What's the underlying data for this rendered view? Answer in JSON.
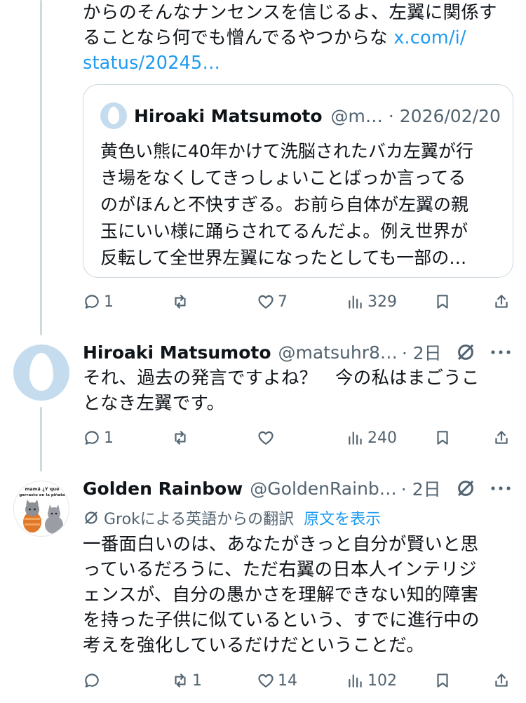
{
  "tweet1": {
    "text_line1": "からのそんなナンセンスを信じるよ、左翼に関係す",
    "text_line2": "ることなら何でも憎んでるやつからな",
    "link_part1": "x.com/i/",
    "link_part2": "status/20245…",
    "quote": {
      "name": "Hiroaki Matsumoto",
      "handle": "@m…",
      "date": "· 2026/02/20",
      "lines": [
        "黄色い熊に40年かけて洗脳されたバカ左翼が行",
        "き場をなくしてきっしょいことばっか言ってる",
        "のがほんと不快すぎる。お前ら自体が左翼の親",
        "玉にいい様に踊らされてるんだよ。例え世界が",
        "反転して全世界左翼になったとしても一部の…"
      ]
    },
    "actions": {
      "replies": "1",
      "reposts": "",
      "likes": "7",
      "views": "329"
    }
  },
  "tweet2": {
    "name": "Hiroaki Matsumoto",
    "handle": "@matsuhr8…",
    "time": "· 2日",
    "lines": [
      "それ、過去の発言ですよね？　今の私はまごうこ",
      "となき左翼です。"
    ],
    "actions": {
      "replies": "1",
      "reposts": "",
      "likes": "",
      "views": "240"
    }
  },
  "tweet3": {
    "name": "Golden Rainbow",
    "handle": "@GoldenRainb…",
    "time": "· 2日",
    "avatar_caption_1": "mamá ¿Y qué",
    "avatar_caption_2": "garrasto en la piñata",
    "translate_label": "Grokによる英語からの翻訳",
    "translate_link": "原文を表示",
    "lines": [
      "一番面白いのは、あなたがきっと自分が賢いと思",
      "っているだろうに、ただ右翼の日本人インテリジ",
      "ェンスが、自分の愚かさを理解できない知的障害",
      "を持った子供に似ているという、すでに進行中の",
      "考えを強化しているだけだということだ。"
    ],
    "actions": {
      "replies": "",
      "reposts": "1",
      "likes": "14",
      "views": "102"
    }
  },
  "icons": {
    "reply": "reply-icon",
    "repost": "repost-icon",
    "like": "heart-icon",
    "views": "views-icon",
    "bookmark": "bookmark-icon",
    "share": "share-icon",
    "grok": "grok-icon",
    "more": "more-icon"
  },
  "colors": {
    "link": "#1d9bf0",
    "secondary": "#536471",
    "text": "#0f1419",
    "line": "#cfd9de"
  }
}
